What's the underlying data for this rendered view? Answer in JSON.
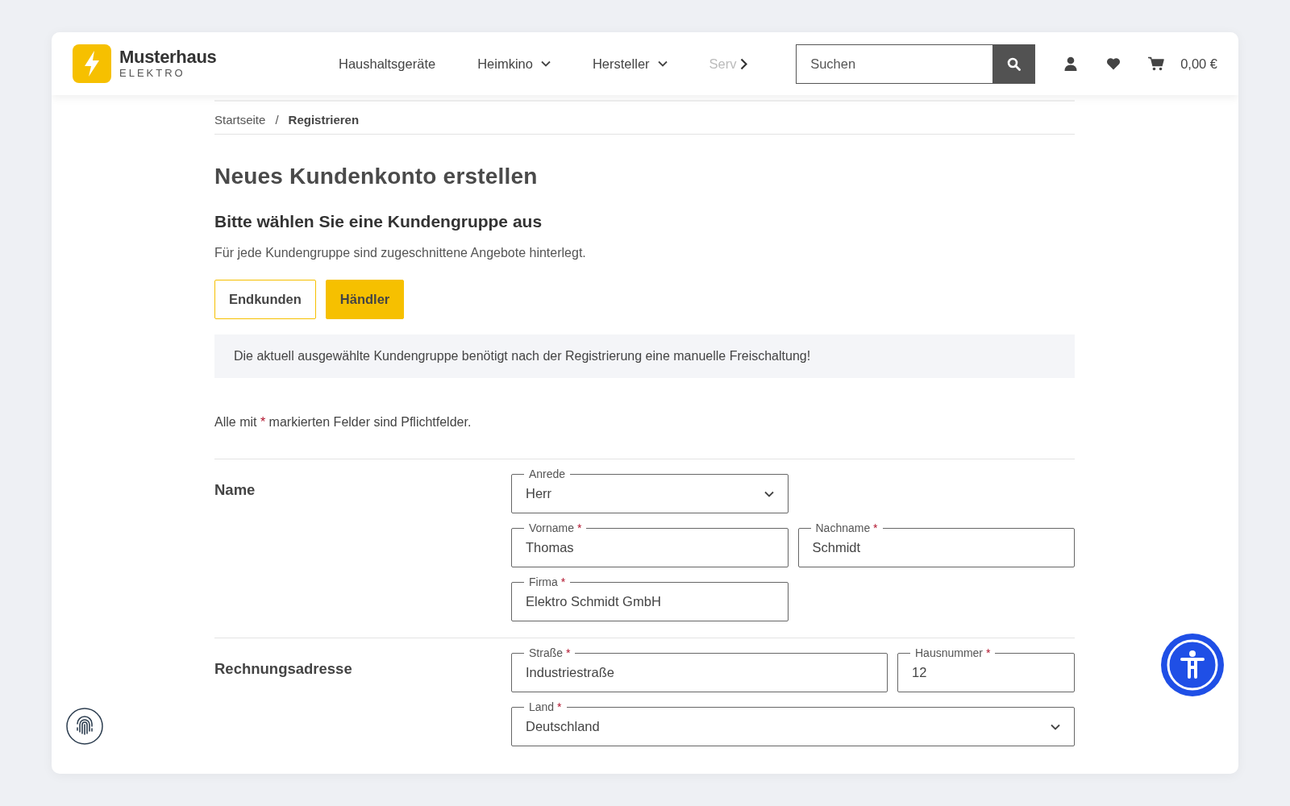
{
  "logo": {
    "name": "Musterhaus",
    "tagline": "ELEKTRO"
  },
  "nav": [
    {
      "label": "Haushaltsgeräte",
      "dropdown": false,
      "faded": false
    },
    {
      "label": "Heimkino",
      "dropdown": true,
      "faded": false
    },
    {
      "label": "Hersteller",
      "dropdown": true,
      "faded": false
    },
    {
      "label": "Serv",
      "dropdown": false,
      "faded": true
    }
  ],
  "search": {
    "placeholder": "Suchen"
  },
  "cart_total": "0,00 €",
  "breadcrumb": {
    "separator": "/",
    "items": [
      {
        "label": "Startseite",
        "current": false
      },
      {
        "label": "Registrieren",
        "current": true
      }
    ]
  },
  "title": "Neues Kundenkonto erstellen",
  "subtitle": "Bitte wählen Sie eine Kundengruppe aus",
  "intro": "Für jede Kundengruppe sind zugeschnittene Angebote hinterlegt.",
  "customer_groups": [
    {
      "label": "Endkunden",
      "selected": false
    },
    {
      "label": "Händler",
      "selected": true
    }
  ],
  "notice": "Die aktuell ausgewählte Kundengruppe benötigt nach der Registrierung eine manuelle Freischaltung!",
  "required_note": {
    "before": "Alle mit",
    "mark": "*",
    "after": "markierten Felder sind Pflichtfelder."
  },
  "sections": [
    {
      "title": "Name",
      "rows": [
        {
          "kind": "half",
          "fields": [
            {
              "kind": "select",
              "label": "Anrede",
              "value": "Herr"
            }
          ]
        },
        {
          "kind": "pair",
          "fields": [
            {
              "kind": "text",
              "label": "Vorname",
              "required_mark": "*",
              "value": "Thomas"
            },
            {
              "kind": "text",
              "label": "Nachname",
              "required_mark": "*",
              "value": "Schmidt"
            }
          ]
        },
        {
          "kind": "half",
          "fields": [
            {
              "kind": "text",
              "label": "Firma",
              "required_mark": "*",
              "value": "Elektro Schmidt GmbH"
            }
          ]
        }
      ]
    },
    {
      "title": "Rechnungsadresse",
      "rows": [
        {
          "kind": "street",
          "fields": [
            {
              "kind": "text",
              "label": "Straße",
              "required_mark": "*",
              "value": "Industriestraße"
            },
            {
              "kind": "text",
              "label": "Hausnummer",
              "required_mark": "*",
              "value": "12"
            }
          ]
        },
        {
          "kind": "full",
          "fields": [
            {
              "kind": "select",
              "label": "Land",
              "required_mark": "*",
              "value": "Deutschland"
            }
          ]
        }
      ]
    }
  ]
}
